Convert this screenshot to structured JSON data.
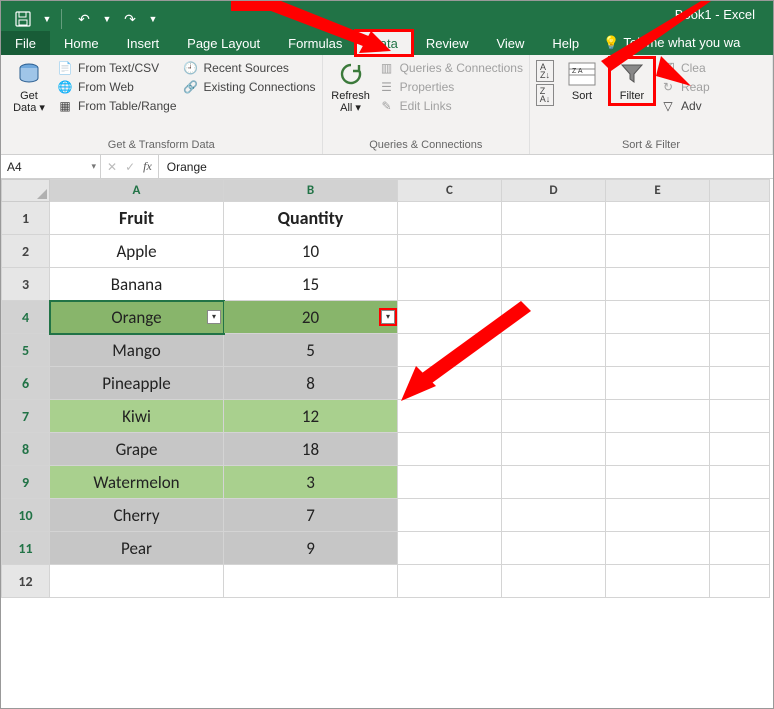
{
  "window": {
    "title": "Book1  -  Excel"
  },
  "qat": {
    "save": "💾",
    "undo": "↶",
    "redo": "↷"
  },
  "tabs": {
    "file": "File",
    "home": "Home",
    "insert": "Insert",
    "pagelayout": "Page Layout",
    "formulas": "Formulas",
    "data": "Data",
    "review": "Review",
    "view": "View",
    "help": "Help",
    "tellme": "Tell me what you wa"
  },
  "ribbon": {
    "getdata": "Get Data ▾",
    "fromtext": "From Text/CSV",
    "fromweb": "From Web",
    "fromtable": "From Table/Range",
    "recent": "Recent Sources",
    "existing": "Existing Connections",
    "group1": "Get & Transform Data",
    "refresh": "Refresh All ▾",
    "queries": "Queries & Connections",
    "properties": "Properties",
    "editlinks": "Edit Links",
    "group2": "Queries & Connections",
    "sort": "Sort",
    "filter": "Filter",
    "clear": "Clea",
    "reapply": "Reap",
    "advanced": "Adv",
    "group3": "Sort & Filter"
  },
  "formulabar": {
    "name": "A4",
    "value": "Orange"
  },
  "columns": [
    "A",
    "B",
    "C",
    "D",
    "E"
  ],
  "rows": [
    "1",
    "2",
    "3",
    "4",
    "5",
    "6",
    "7",
    "8",
    "9",
    "10",
    "11",
    "12"
  ],
  "table": {
    "headers": {
      "fruit": "Fruit",
      "qty": "Quantity"
    },
    "data": [
      {
        "fruit": "Apple",
        "qty": "10"
      },
      {
        "fruit": "Banana",
        "qty": "15"
      },
      {
        "fruit": "Orange",
        "qty": "20"
      },
      {
        "fruit": "Mango",
        "qty": "5"
      },
      {
        "fruit": "Pineapple",
        "qty": "8"
      },
      {
        "fruit": "Kiwi",
        "qty": "12"
      },
      {
        "fruit": "Grape",
        "qty": "18"
      },
      {
        "fruit": "Watermelon",
        "qty": "3"
      },
      {
        "fruit": "Cherry",
        "qty": "7"
      },
      {
        "fruit": "Pear",
        "qty": "9"
      }
    ]
  }
}
